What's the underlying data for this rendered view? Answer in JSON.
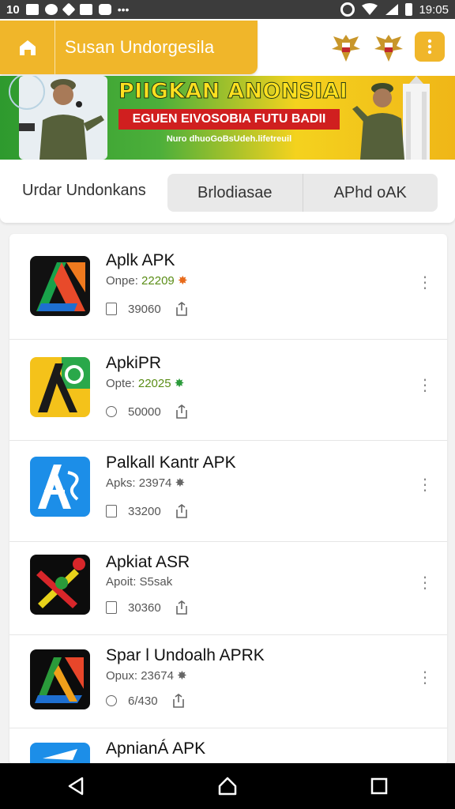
{
  "status_bar": {
    "left_text": "10",
    "time": "19:05",
    "icons": [
      "mail-icon",
      "navigation-icon",
      "send-icon",
      "stop-icon",
      "settings-icon",
      "more-icon",
      "wifi-icon",
      "signal-icon",
      "battery-icon"
    ]
  },
  "app_bar": {
    "title": "Susan Undorgesila",
    "home_icon": "home-icon",
    "menu_icon": "vertical-dots-icon",
    "accent_color": "#f0b62a"
  },
  "banner": {
    "headline": "PIIGKAN ANONSIAI",
    "subline": "EGUEN EIVOSOBIA FUTU BADII",
    "small_text": "Nuro dhuoGoBsUdeh.lifetreuil"
  },
  "tabs": {
    "first": "Urdar Undonkans",
    "second": "Brlodiasae",
    "third": "APhd oAK"
  },
  "apps": [
    {
      "name": "Aplk APK",
      "meta_label": "Onpe:",
      "meta_value": "22209",
      "size": "39060",
      "stat_icon": "file-icon"
    },
    {
      "name": "ApkiPR",
      "meta_label": "Opte:",
      "meta_value": "22025",
      "size": "50000",
      "stat_icon": "clock-icon"
    },
    {
      "name": "Palkall Kantr APK",
      "meta_label": "Apks:",
      "meta_value": "23974",
      "size": "33200",
      "stat_icon": "file-icon"
    },
    {
      "name": "Apkiat ASR",
      "meta_label": "Apoit:",
      "meta_value": "S5sak",
      "size": "30360",
      "stat_icon": "file-icon"
    },
    {
      "name": "Spar l Undoalh APRK",
      "meta_label": "Opux:",
      "meta_value": "23674",
      "size": "6/430",
      "stat_icon": "clock-icon"
    },
    {
      "name": "ApnianÁ APK",
      "meta_label": "",
      "meta_value": "",
      "size": "",
      "stat_icon": ""
    }
  ],
  "nav": {
    "back_icon": "back-triangle-icon",
    "home_icon": "home-outline-icon",
    "recents_icon": "recents-square-icon"
  }
}
